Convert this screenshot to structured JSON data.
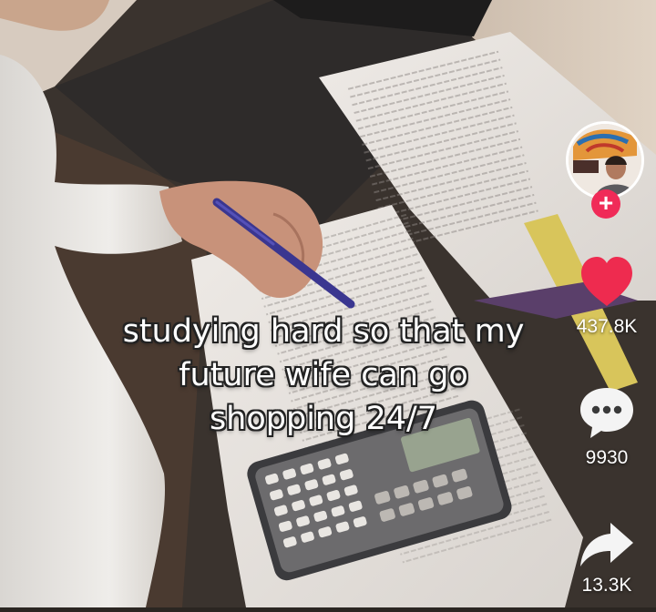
{
  "caption": {
    "lines": [
      "studying hard so that my",
      "future wife can go",
      "shopping 24/7"
    ]
  },
  "creator": {
    "avatar_icon": "profile-avatar",
    "follow_label": "+"
  },
  "actions": {
    "like": {
      "icon": "heart-icon",
      "count": "437.8K",
      "color": "#ee2b4f"
    },
    "comment": {
      "icon": "comment-bubble-icon",
      "count": "9930"
    },
    "share": {
      "icon": "share-arrow-icon",
      "count": "13.3K"
    }
  }
}
